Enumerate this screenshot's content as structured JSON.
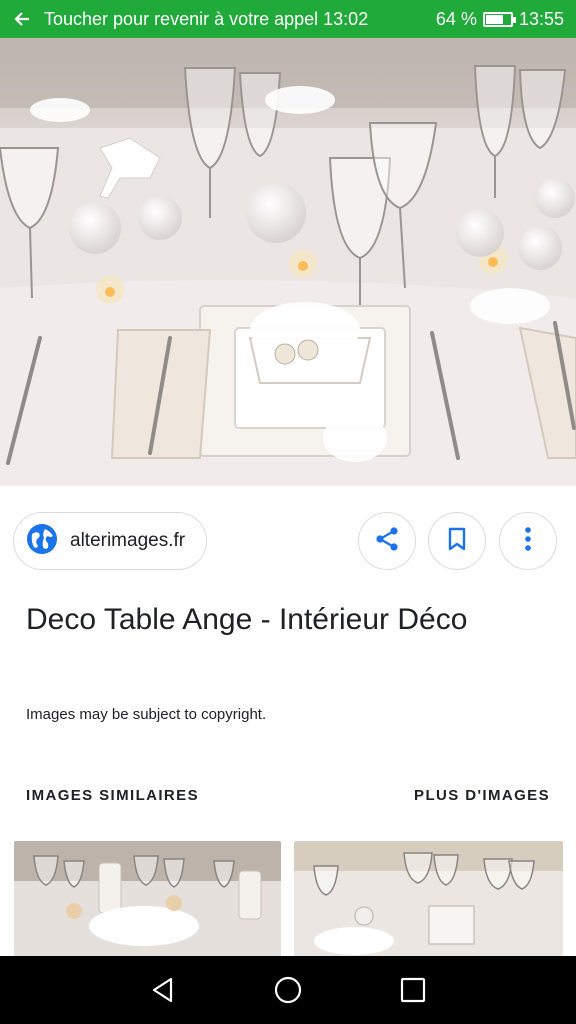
{
  "status_bar": {
    "call_banner_text": "Toucher pour revenir à votre appel 13:02",
    "battery_text": "64 %",
    "battery_level": 0.64,
    "clock": "13:55"
  },
  "hero_image": {
    "icon": "photo-table-decoration"
  },
  "source": {
    "domain": "alterimages.fr",
    "icon": "globe-icon"
  },
  "actions": [
    {
      "name": "share",
      "icon": "share-icon"
    },
    {
      "name": "save",
      "icon": "bookmark-icon"
    },
    {
      "name": "more",
      "icon": "more-vert-icon"
    }
  ],
  "title": "Deco Table Ange - Intérieur Déco",
  "copyright_notice": "Images may be subject to copyright.",
  "sections": {
    "similar_label": "IMAGES SIMILAIRES",
    "more_label": "PLUS D'IMAGES"
  },
  "colors": {
    "call_banner": "#1faa3a",
    "accent_blue": "#1a73e8"
  },
  "nav": [
    "back-icon",
    "home-icon",
    "recents-icon"
  ]
}
